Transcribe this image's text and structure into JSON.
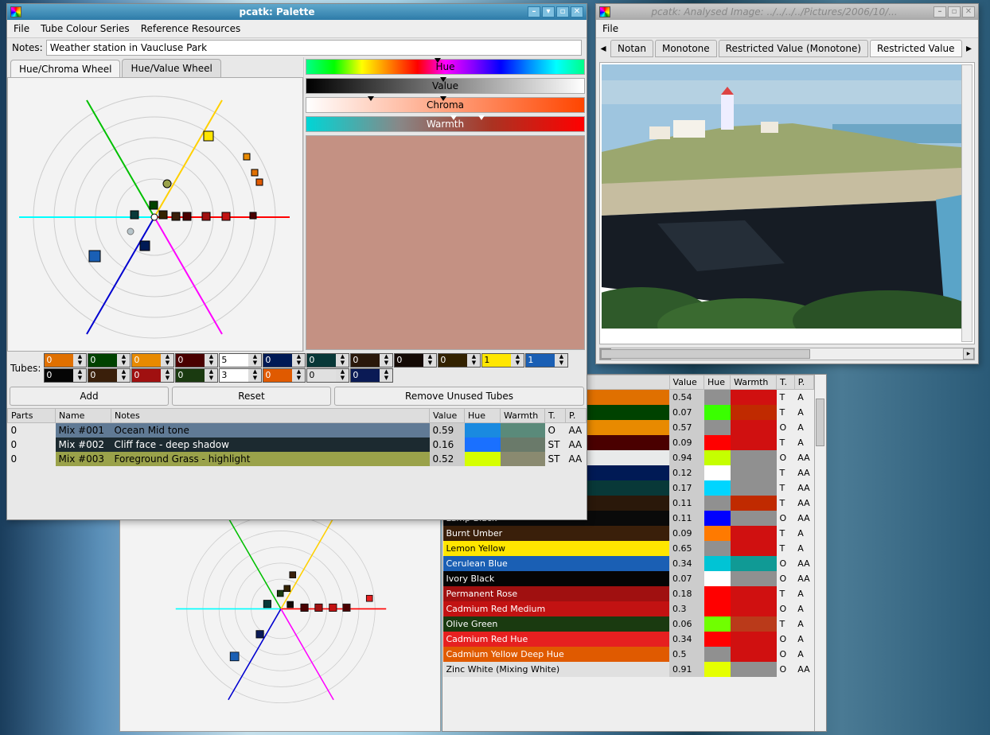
{
  "palette_window": {
    "title": "pcatk: Palette",
    "menu": [
      "File",
      "Tube Colour Series",
      "Reference Resources"
    ],
    "notes_label": "Notes:",
    "notes_value": "Weather station in Vaucluse Park",
    "wheel_tabs": [
      "Hue/Chroma Wheel",
      "Hue/Value Wheel"
    ],
    "sliders": {
      "hue": "Hue",
      "value": "Value",
      "chroma": "Chroma",
      "warmth": "Warmth"
    },
    "preview_color": "#c49183",
    "tubes_label": "Tubes:",
    "tube_spins_top": [
      {
        "c": "#e07000",
        "v": "0"
      },
      {
        "c": "#004200",
        "v": "0"
      },
      {
        "c": "#e88a00",
        "v": "0"
      },
      {
        "c": "#4a0000",
        "v": "0"
      },
      {
        "c": "#ffffff",
        "v": "5"
      },
      {
        "c": "#001a55",
        "v": "0"
      },
      {
        "c": "#083838",
        "v": "0"
      },
      {
        "c": "#2a180a",
        "v": "0"
      },
      {
        "c": "#140a05",
        "v": "0"
      },
      {
        "c": "#332200",
        "v": "0"
      },
      {
        "c": "#ffe600",
        "v": "1"
      },
      {
        "c": "#1a5fb4",
        "v": "1"
      }
    ],
    "tube_spins_bot": [
      {
        "c": "#050505",
        "v": "0"
      },
      {
        "c": "#3a1f0a",
        "v": "0"
      },
      {
        "c": "#a01010",
        "v": "0"
      },
      {
        "c": "#1a3a10",
        "v": "0"
      },
      {
        "c": "#ffffff",
        "v": "3"
      },
      {
        "c": "#e05a00",
        "v": "0"
      },
      {
        "c": "#e0e0e0",
        "v": "0"
      },
      {
        "c": "#0a1a55",
        "v": "0"
      }
    ],
    "buttons": {
      "add": "Add",
      "reset": "Reset",
      "remove": "Remove Unused Tubes"
    },
    "mix_headers": [
      "Parts",
      "Name",
      "Notes",
      "Value",
      "Hue",
      "Warmth",
      "T.",
      "P."
    ],
    "mixes": [
      {
        "parts": "0",
        "name": "Mix #001",
        "notes": "Ocean Mid tone",
        "value": "0.59",
        "hue": "#1a8ae0",
        "warmth": "#5a8a7a",
        "t": "O",
        "p": "AA",
        "rowbg": "#607a95",
        "txt": "#000"
      },
      {
        "parts": "0",
        "name": "Mix #002",
        "notes": "Cliff face - deep shadow",
        "value": "0.16",
        "hue": "#1a70ff",
        "warmth": "#6a7a6a",
        "t": "ST",
        "p": "AA",
        "rowbg": "#1c2a30",
        "txt": "#fff"
      },
      {
        "parts": "0",
        "name": "Mix #003",
        "notes": "Foreground Grass - highlight",
        "value": "0.52",
        "hue": "#d5ff00",
        "warmth": "#8a8a70",
        "t": "ST",
        "p": "AA",
        "rowbg": "#9aa24a",
        "txt": "#000"
      }
    ]
  },
  "analysed_window": {
    "title": "pcatk: Analysed Image: ../../../../Pictures/2006/10/...",
    "menu": [
      "File"
    ],
    "tabs": [
      "Notan",
      "Monotone",
      "Restricted Value (Monotone)",
      "Restricted Value"
    ],
    "active_tab": 3
  },
  "tube_table": {
    "headers": [
      "",
      "Value",
      "Hue",
      "Warmth",
      "T.",
      "P."
    ],
    "rows": [
      {
        "name": "",
        "bg": "#e07000",
        "val": "0.54",
        "hue": "#909090",
        "warm": "#d01010",
        "t": "T",
        "p": "A",
        "txt": "#fff"
      },
      {
        "name": "",
        "bg": "#004200",
        "val": "0.07",
        "hue": "#3aff00",
        "warm": "#c02a00",
        "t": "T",
        "p": "A",
        "txt": "#fff"
      },
      {
        "name": "",
        "bg": "#e88a00",
        "val": "0.57",
        "hue": "#909090",
        "warm": "#d01010",
        "t": "O",
        "p": "A",
        "txt": "#fff"
      },
      {
        "name": "",
        "bg": "#4a0000",
        "val": "0.09",
        "hue": "#ff0000",
        "warm": "#d01010",
        "t": "T",
        "p": "A",
        "txt": "#fff"
      },
      {
        "name": "",
        "bg": "#e8eaea",
        "val": "0.94",
        "hue": "#c5ff00",
        "warm": "#909090",
        "t": "O",
        "p": "AA",
        "txt": "#000"
      },
      {
        "name": "",
        "bg": "#001a55",
        "val": "0.12",
        "hue": "#ffffff",
        "warm": "#909090",
        "t": "T",
        "p": "AA",
        "txt": "#fff"
      },
      {
        "name": "",
        "bg": "#083838",
        "val": "0.17",
        "hue": "#00d5ff",
        "warm": "#909090",
        "t": "T",
        "p": "AA",
        "txt": "#fff"
      },
      {
        "name": "",
        "bg": "#2a180a",
        "val": "0.11",
        "hue": "#909090",
        "warm": "#c02a00",
        "t": "T",
        "p": "AA",
        "txt": "#fff"
      },
      {
        "name": "Lamp Black",
        "bg": "#0a0a0a",
        "val": "0.11",
        "hue": "#0000ff",
        "warm": "#909090",
        "t": "O",
        "p": "AA",
        "txt": "#fff"
      },
      {
        "name": "Burnt Umber",
        "bg": "#3a1f0a",
        "val": "0.09",
        "hue": "#ff7a00",
        "warm": "#d01010",
        "t": "T",
        "p": "A",
        "txt": "#fff"
      },
      {
        "name": "Lemon Yellow",
        "bg": "#ffe600",
        "val": "0.65",
        "hue": "#909090",
        "warm": "#d01010",
        "t": "T",
        "p": "A",
        "txt": "#000"
      },
      {
        "name": "Cerulean Blue",
        "bg": "#1a5fb4",
        "val": "0.34",
        "hue": "#00c4d5",
        "warm": "#109a95",
        "t": "O",
        "p": "AA",
        "txt": "#fff"
      },
      {
        "name": "Ivory Black",
        "bg": "#050505",
        "val": "0.07",
        "hue": "#ffffff",
        "warm": "#909090",
        "t": "O",
        "p": "AA",
        "txt": "#fff"
      },
      {
        "name": "Permanent Rose",
        "bg": "#a01010",
        "val": "0.18",
        "hue": "#ff0000",
        "warm": "#d01010",
        "t": "T",
        "p": "A",
        "txt": "#fff"
      },
      {
        "name": "Cadmium Red Medium",
        "bg": "#c21212",
        "val": "0.3",
        "hue": "#ff0000",
        "warm": "#d01010",
        "t": "O",
        "p": "A",
        "txt": "#fff"
      },
      {
        "name": "Olive Green",
        "bg": "#1a3a10",
        "val": "0.06",
        "hue": "#70ff00",
        "warm": "#ba3a1a",
        "t": "T",
        "p": "A",
        "txt": "#fff"
      },
      {
        "name": "Cadmium Red Hue",
        "bg": "#e62020",
        "val": "0.34",
        "hue": "#ff0000",
        "warm": "#d01010",
        "t": "O",
        "p": "A",
        "txt": "#fff"
      },
      {
        "name": "Cadmium Yellow Deep Hue",
        "bg": "#e05a00",
        "val": "0.5",
        "hue": "#909090",
        "warm": "#d01010",
        "t": "O",
        "p": "A",
        "txt": "#fff"
      },
      {
        "name": "Zinc White (Mixing White)",
        "bg": "#e0e0e0",
        "val": "0.91",
        "hue": "#e5ff00",
        "warm": "#909090",
        "t": "O",
        "p": "AA",
        "txt": "#000"
      }
    ]
  }
}
